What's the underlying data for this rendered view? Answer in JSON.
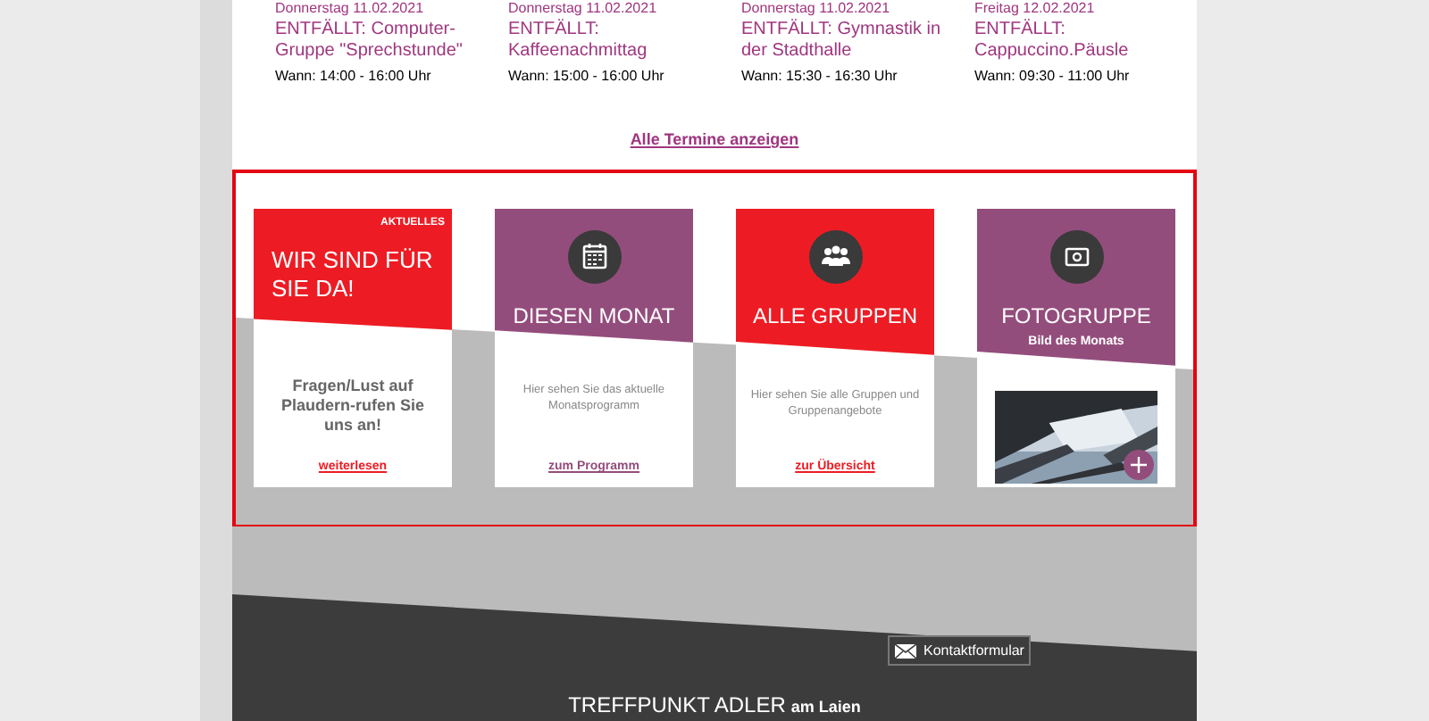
{
  "events": [
    {
      "date": "Donnerstag 11.02.2021",
      "title": "ENTFÄLLT: Computer-Gruppe \"Sprechstunde\"",
      "time": "Wann: 14:00 - 16:00 Uhr"
    },
    {
      "date": "Donnerstag 11.02.2021",
      "title": "ENTFÄLLT: Kaffeenachmittag",
      "time": "Wann: 15:00 - 16:00 Uhr"
    },
    {
      "date": "Donnerstag 11.02.2021",
      "title": "ENTFÄLLT: Gymnastik in der Stadthalle",
      "time": "Wann: 15:30 - 16:30 Uhr"
    },
    {
      "date": "Freitag 12.02.2021",
      "title": "ENTFÄLLT: Cappuccino.Päusle",
      "time": "Wann: 09:30 - 11:00 Uhr"
    }
  ],
  "all_events_link": "Alle Termine anzeigen",
  "tiles": [
    {
      "kind": "text",
      "color": "#ed1c24",
      "badge": "AKTUELLES",
      "title": "WIR SIND FÜR SIE DA!",
      "text": "Fragen/Lust auf Plaudern-rufen Sie uns an!",
      "link": "weiterlesen"
    },
    {
      "kind": "calendar",
      "color": "#934d7c",
      "title": "DIESEN MONAT",
      "text": "Hier sehen Sie das aktuelle Monatsprogramm",
      "link": "zum Programm"
    },
    {
      "kind": "groups",
      "color": "#ed1c24",
      "title": "ALLE GRUPPEN",
      "text": "Hier sehen Sie alle Gruppen und Gruppenangebote",
      "link": "zur Übersicht"
    },
    {
      "color": "#934d7c",
      "title": "FOTOGRUPPE",
      "subtitle": "Bild des Monats"
    }
  ],
  "footer": {
    "contact_button": "Kontaktformular",
    "brand": "TREFFPUNKT ADLER",
    "brand_suffix": "am Laien"
  }
}
